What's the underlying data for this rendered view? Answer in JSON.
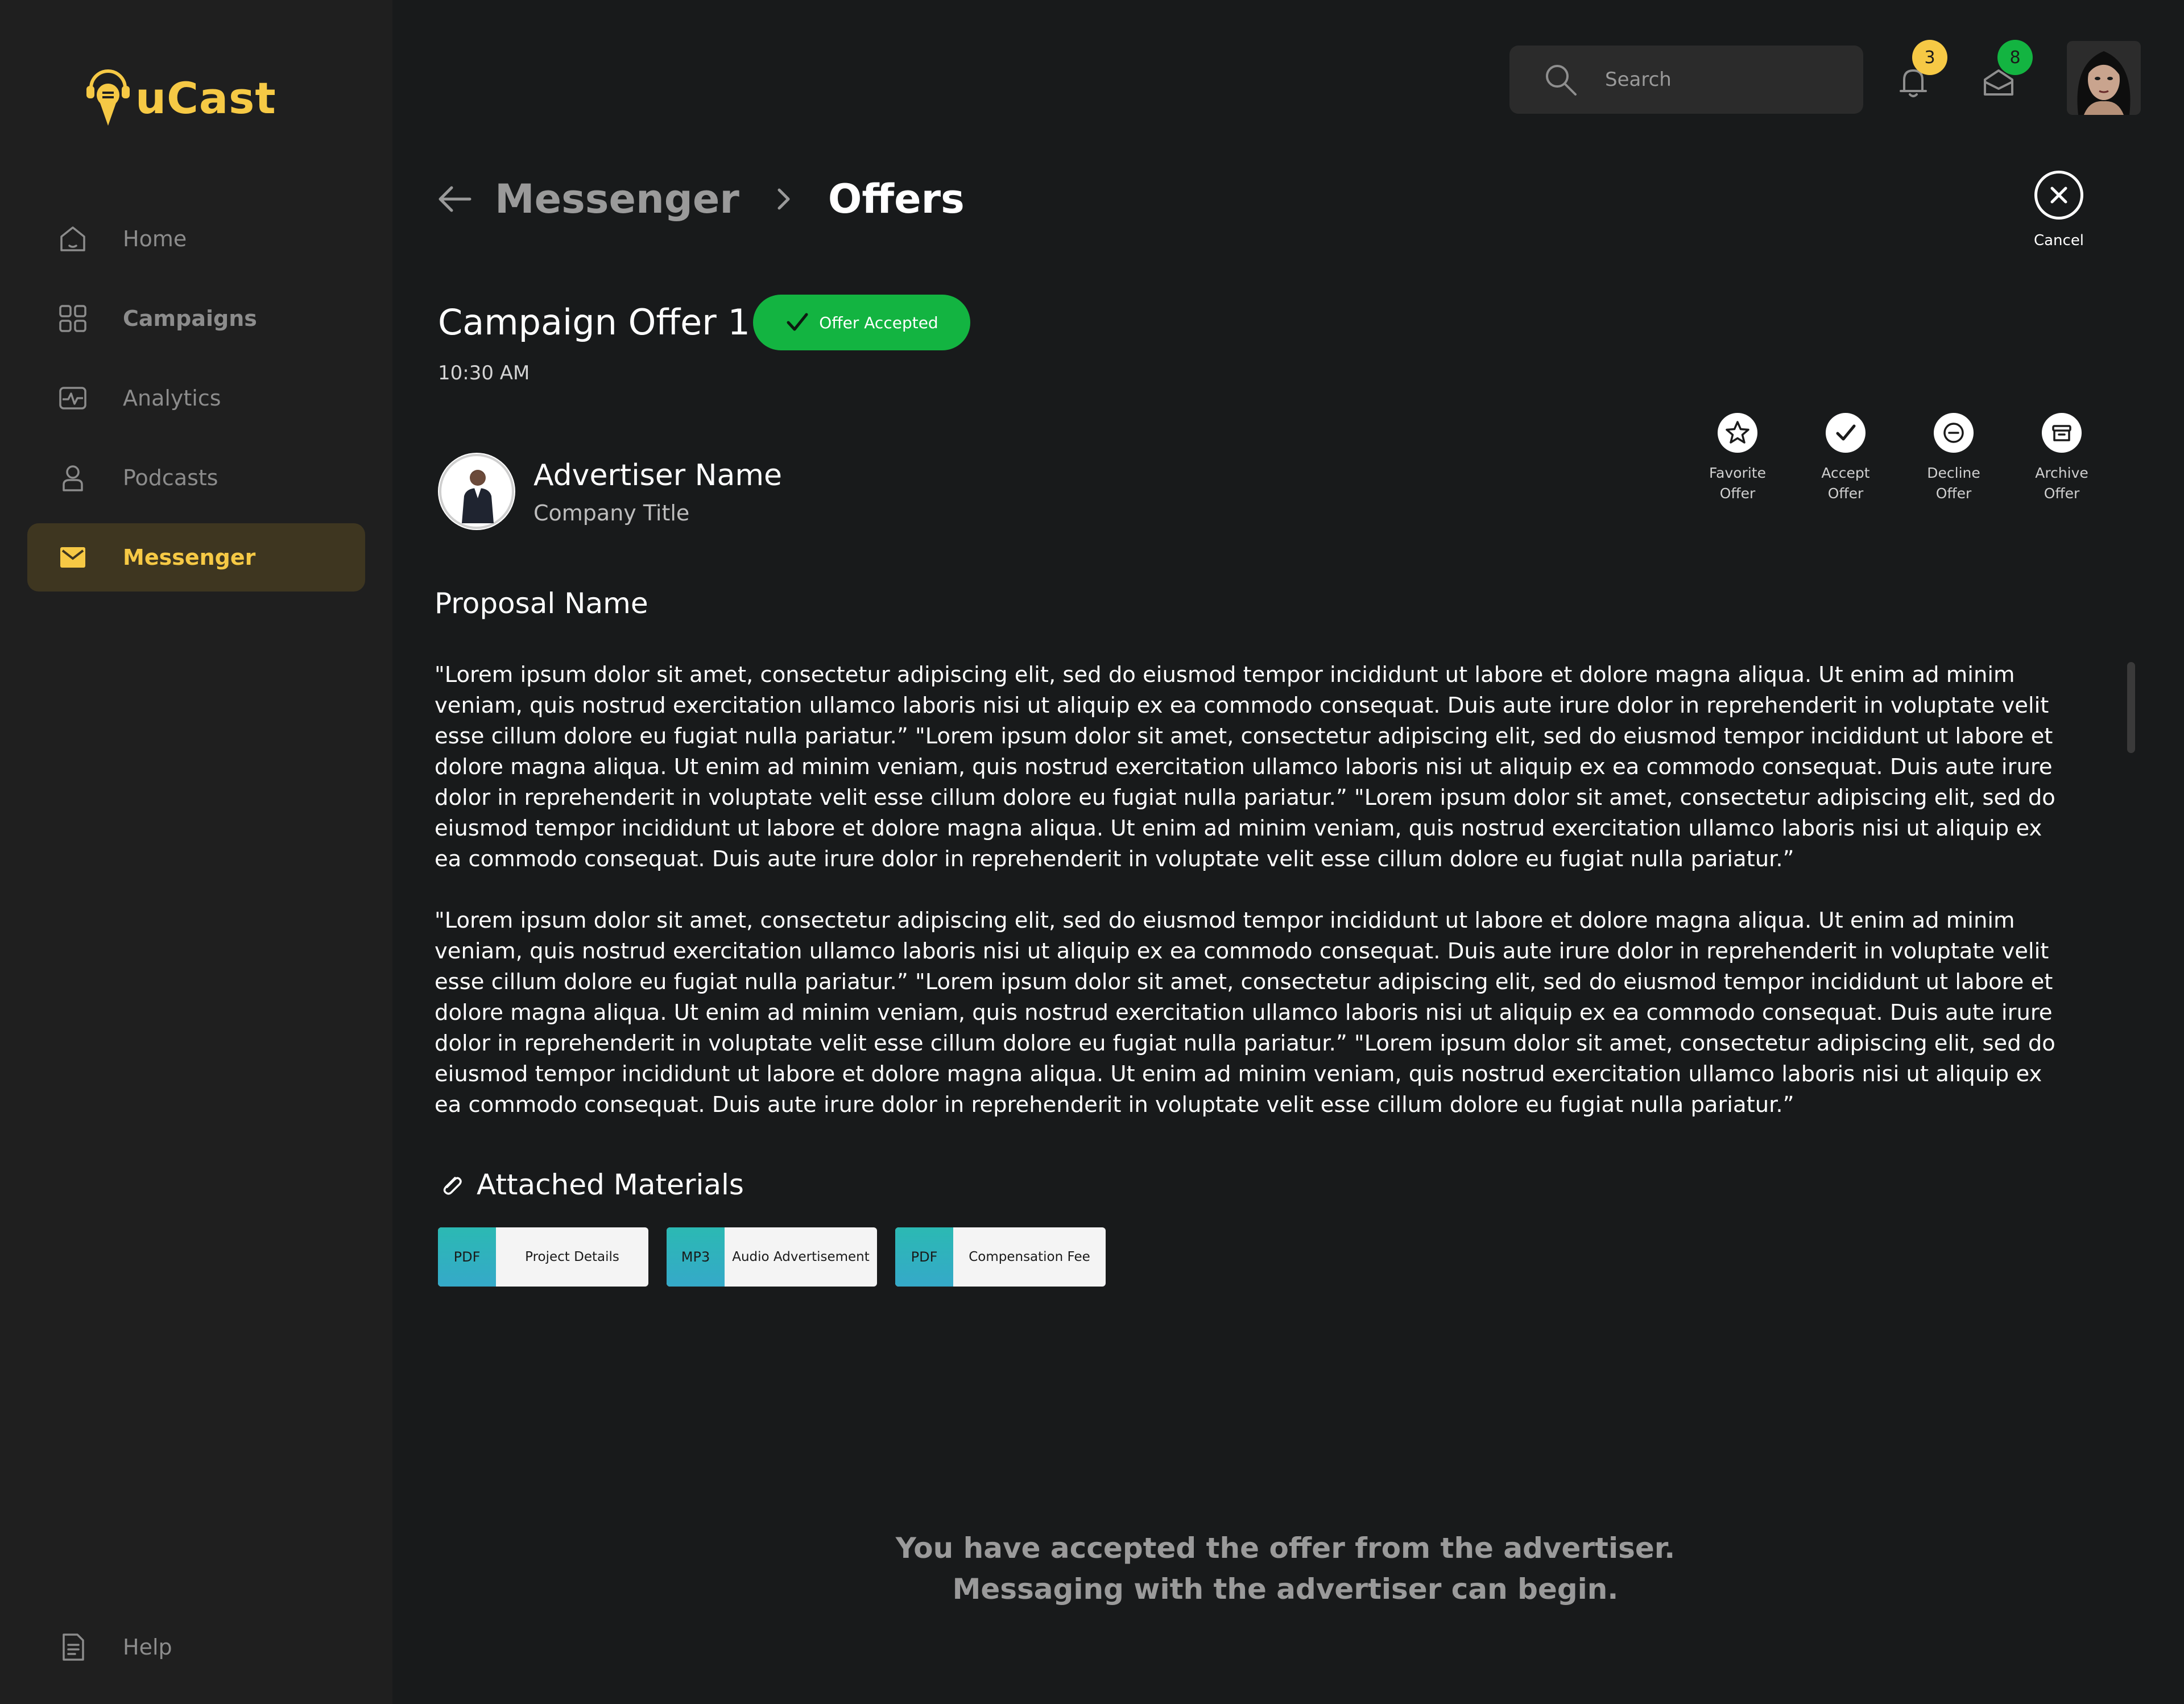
{
  "app": {
    "name": "uCast",
    "brand_color": "#f6c945"
  },
  "sidebar": {
    "items": [
      {
        "label": "Home",
        "icon": "home-icon"
      },
      {
        "label": "Campaigns",
        "icon": "grid-icon"
      },
      {
        "label": "Analytics",
        "icon": "analytics-icon"
      },
      {
        "label": "Podcasts",
        "icon": "user-icon"
      },
      {
        "label": "Messenger",
        "icon": "mail-icon",
        "active": true
      }
    ],
    "help_label": "Help"
  },
  "topbar": {
    "search_placeholder": "Search",
    "notifications_count": "3",
    "messages_count": "8"
  },
  "breadcrumb": {
    "parent": "Messenger",
    "current": "Offers"
  },
  "cancel_label": "Cancel",
  "offer": {
    "title": "Campaign Offer 1",
    "status": "Offer Accepted",
    "status_color": "#13b441",
    "time": "10:30 AM"
  },
  "advertiser": {
    "name": "Advertiser Name",
    "company": "Company Title"
  },
  "actions": [
    {
      "label": "Favorite\nOffer",
      "icon": "star-icon"
    },
    {
      "label": "Accept\nOffer",
      "icon": "check-icon"
    },
    {
      "label": "Decline\nOffer",
      "icon": "minus-circle-icon"
    },
    {
      "label": "Archive\nOffer",
      "icon": "archive-icon"
    }
  ],
  "proposal": {
    "name": "Proposal Name",
    "paragraphs": [
      "\"Lorem ipsum dolor sit amet, consectetur adipiscing elit, sed do eiusmod tempor incididunt ut labore et dolore magna aliqua. Ut enim ad minim veniam, quis nostrud exercitation ullamco laboris nisi ut aliquip ex ea commodo consequat. Duis aute irure dolor in reprehenderit in voluptate velit esse cillum dolore eu fugiat nulla pariatur.” \"Lorem ipsum dolor sit amet, consectetur adipiscing elit, sed do eiusmod tempor incididunt ut labore et dolore magna aliqua. Ut enim ad minim veniam, quis nostrud exercitation ullamco laboris nisi ut aliquip ex ea commodo consequat. Duis aute irure dolor in reprehenderit in voluptate velit esse cillum dolore eu fugiat nulla pariatur.” \"Lorem ipsum dolor sit amet, consectetur adipiscing elit, sed do eiusmod tempor incididunt ut labore et dolore magna aliqua. Ut enim ad minim veniam, quis nostrud exercitation ullamco laboris nisi ut aliquip ex ea commodo consequat. Duis aute irure dolor in reprehenderit in voluptate velit esse cillum dolore eu fugiat nulla pariatur.”",
      "\"Lorem ipsum dolor sit amet, consectetur adipiscing elit, sed do eiusmod tempor incididunt ut labore et dolore magna aliqua. Ut enim ad minim veniam, quis nostrud exercitation ullamco laboris nisi ut aliquip ex ea commodo consequat. Duis aute irure dolor in reprehenderit in voluptate velit esse cillum dolore eu fugiat nulla pariatur.” \"Lorem ipsum dolor sit amet, consectetur adipiscing elit, sed do eiusmod tempor incididunt ut labore et dolore magna aliqua. Ut enim ad minim veniam, quis nostrud exercitation ullamco laboris nisi ut aliquip ex ea commodo consequat. Duis aute irure dolor in reprehenderit in voluptate velit esse cillum dolore eu fugiat nulla pariatur.” \"Lorem ipsum dolor sit amet, consectetur adipiscing elit, sed do eiusmod tempor incididunt ut labore et dolore magna aliqua. Ut enim ad minim veniam, quis nostrud exercitation ullamco laboris nisi ut aliquip ex ea commodo consequat. Duis aute irure dolor in reprehenderit in voluptate velit esse cillum dolore eu fugiat nulla pariatur.”"
    ]
  },
  "attachments": {
    "title": "Attached Materials",
    "files": [
      {
        "type": "PDF",
        "name": "Project Details"
      },
      {
        "type": "MP3",
        "name": "Audio Advertisement"
      },
      {
        "type": "PDF",
        "name": "Compensation  Fee"
      }
    ]
  },
  "footer": {
    "line1": "You have accepted the offer from the advertiser.",
    "line2": "Messaging with the advertiser can begin."
  }
}
